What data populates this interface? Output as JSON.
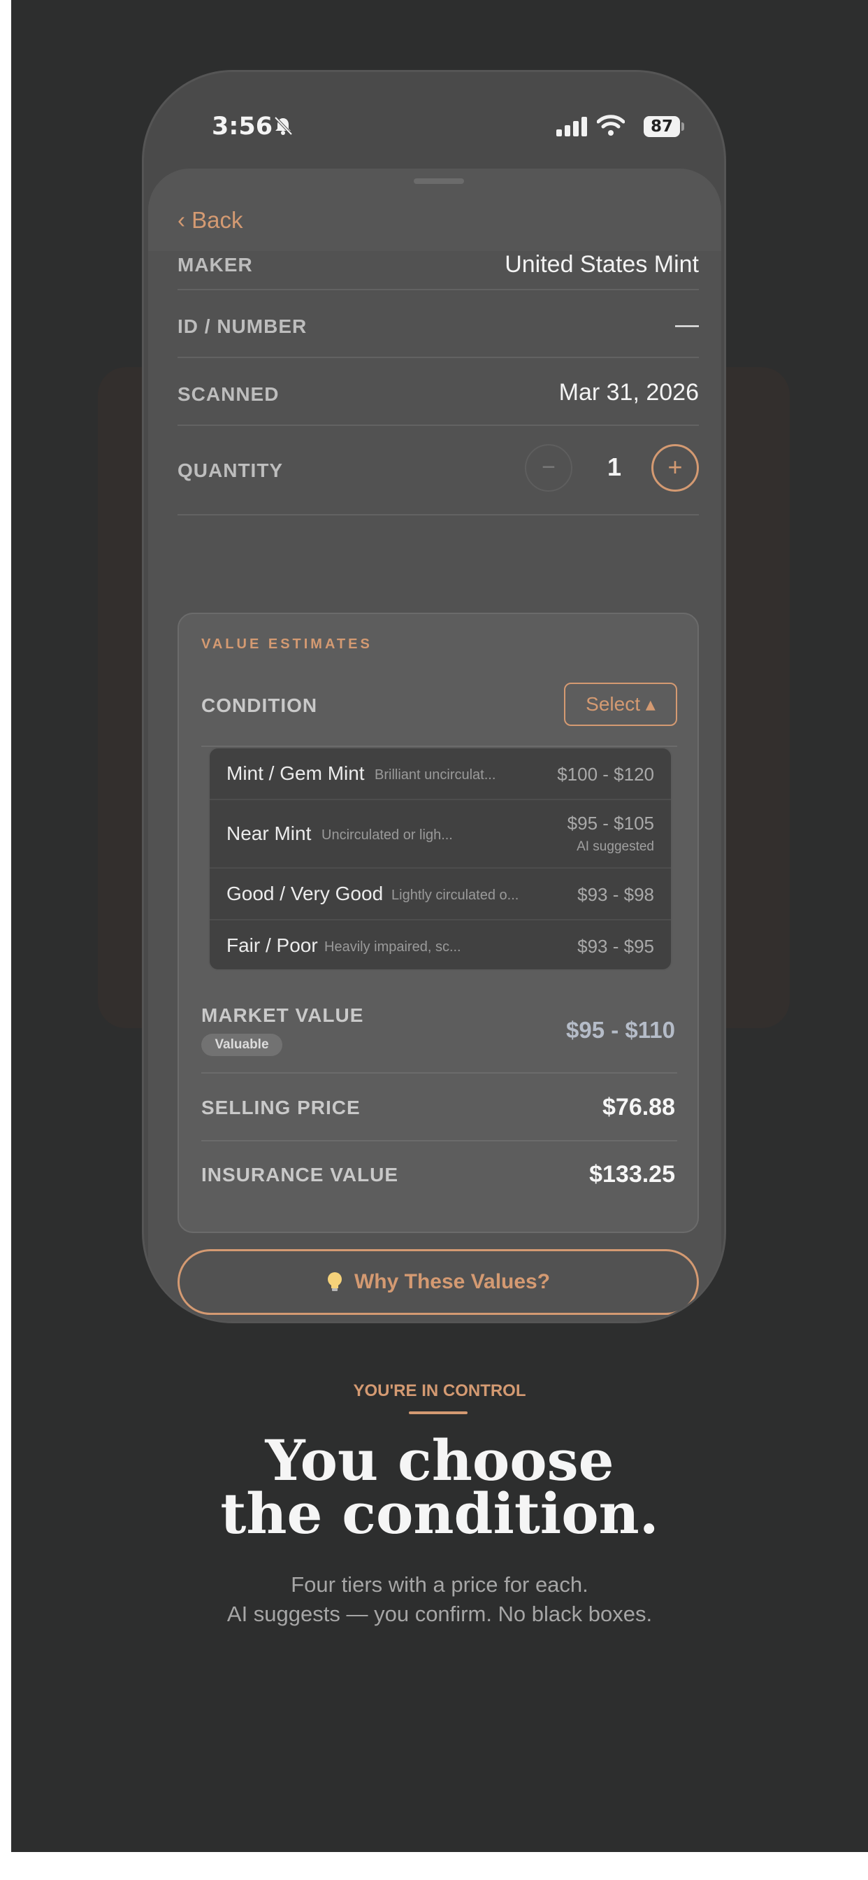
{
  "status_bar": {
    "time": "3:56",
    "battery": "87"
  },
  "nav": {
    "back_label": "‹ Back"
  },
  "details": [
    {
      "label": "MAKER",
      "value": "United States Mint"
    },
    {
      "label": "ID / NUMBER",
      "value": "—"
    },
    {
      "label": "SCANNED",
      "value": "Mar 31, 2026"
    }
  ],
  "quantity": {
    "label": "QUANTITY",
    "value": "1",
    "minus": "−",
    "plus": "+"
  },
  "value_card": {
    "title": "VALUE ESTIMATES",
    "condition_label": "CONDITION",
    "select_label": "Select ▴",
    "options": [
      {
        "name": "Mint / Gem Mint",
        "desc": "Brilliant uncirculat...",
        "price": "$100 - $120"
      },
      {
        "name": "Near Mint",
        "desc": "Uncirculated or ligh...",
        "price": "$95 - $105",
        "note": "AI suggested"
      },
      {
        "name": "Good / Very Good",
        "desc": "Lightly circulated o...",
        "price": "$93 - $98"
      },
      {
        "name": "Fair / Poor",
        "desc": "Heavily impaired, sc...",
        "price": "$93 - $95"
      }
    ],
    "market_value_label": "MARKET VALUE",
    "market_badge": "Valuable",
    "market_value": "$95 - $110",
    "selling_price_label": "SELLING PRICE",
    "selling_price": "$76.88",
    "insurance_value_label": "INSURANCE VALUE",
    "insurance_value": "$133.25"
  },
  "why_button": "Why These Values?",
  "marketing": {
    "eyebrow": "YOU'RE IN CONTROL",
    "headline_line1": "You choose",
    "headline_line2": "the condition.",
    "sub_line1": "Four tiers with a price for each.",
    "sub_line2": "AI suggests — you confirm. No black boxes."
  },
  "colors": {
    "accent": "#d49a72",
    "background": "#2d2e2e",
    "sheet": "#525252"
  }
}
